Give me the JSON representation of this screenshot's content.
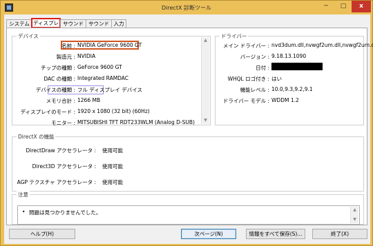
{
  "window": {
    "title": "DirectX 診断ツール",
    "minimize": "─",
    "maximize": "□",
    "close": "x"
  },
  "tabs": [
    "システム",
    "ディスプレイ",
    "サウンド 1",
    "サウンド 2",
    "入力"
  ],
  "device": {
    "title": "デバイス",
    "rows": [
      {
        "label": "名前 :",
        "value": "NVIDIA GeForce 9600 GT"
      },
      {
        "label": "製造元 :",
        "value": "NVIDIA"
      },
      {
        "label": "チップの種類 :",
        "value": "GeForce 9600 GT"
      },
      {
        "label": "DAC の種類 :",
        "value": "Integrated RAMDAC"
      },
      {
        "label": "デバイスの種類 :",
        "value": "フル ディスプレイ デバイス"
      },
      {
        "label": "メモリ合計 :",
        "value": "1266 MB"
      },
      {
        "label": "ディスプレイのモード :",
        "value": "1920 x 1080 (32 bit) (60Hz)"
      },
      {
        "label": "モニター :",
        "value": "MITSUBISHI TFT RDT233WLM (Analog D-SUB)"
      }
    ]
  },
  "driver": {
    "title": "ドライバー",
    "rows": [
      {
        "label": "メイン ドライバー :",
        "value": "nvd3dum.dll,nvwgf2um.dll,nvwgf2um.dll"
      },
      {
        "label": "バージョン :",
        "value": "9.18.13.1090"
      },
      {
        "label": "日付 :",
        "value": ""
      },
      {
        "label": "WHQL ロゴ付き :",
        "value": "はい"
      },
      {
        "label": "機能レベル :",
        "value": "10.0,9.3,9.2,9.1"
      },
      {
        "label": "ドライバー モデル :",
        "value": "WDDM 1.2"
      }
    ]
  },
  "features": {
    "title": "DirectX の機能",
    "rows": [
      {
        "label": "DirectDraw アクセラレータ :",
        "value": "使用可能"
      },
      {
        "label": "Direct3D アクセラレータ :",
        "value": "使用可能"
      },
      {
        "label": "AGP テクスチャ アクセラレータ :",
        "value": "使用可能"
      }
    ]
  },
  "notes": {
    "title": "注意",
    "bullet": "•",
    "text": "問題は見つかりませんでした。"
  },
  "buttons": {
    "help": "ヘルプ(H)",
    "next": "次ページ(N)",
    "save": "情報をすべて保存(S)...",
    "exit": "終了(X)"
  }
}
